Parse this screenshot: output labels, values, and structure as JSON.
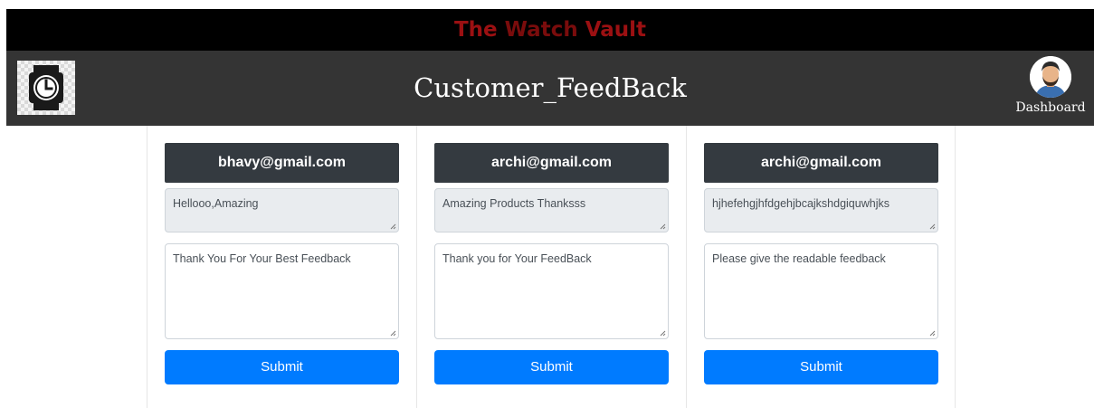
{
  "brand": {
    "part1": "The ",
    "part2": "Watch",
    "part3": " Vault"
  },
  "header": {
    "title": "Customer_FeedBack",
    "dashboard_label": "Dashboard"
  },
  "feedbacks": [
    {
      "email": "bhavy@gmail.com",
      "message": "Hellooo,Amazing",
      "reply": "Thank You For Your Best Feedback",
      "submit_label": "Submit"
    },
    {
      "email": "archi@gmail.com",
      "message": "Amazing Products Thanksss",
      "reply": "Thank you for Your FeedBack",
      "submit_label": "Submit"
    },
    {
      "email": "archi@gmail.com",
      "message": "hjhefehgjhfdgehjbcajkshdgiquwhjks",
      "reply": "Please give the readable feedback",
      "submit_label": "Submit"
    }
  ],
  "colors": {
    "brand_red": "#9b1012",
    "header_bg": "#343434",
    "email_bg": "#343a40",
    "submit_bg": "#007bff"
  },
  "icons": {
    "logo": "watch-icon",
    "avatar": "user-avatar-icon",
    "resize": "resize-grip-icon"
  }
}
